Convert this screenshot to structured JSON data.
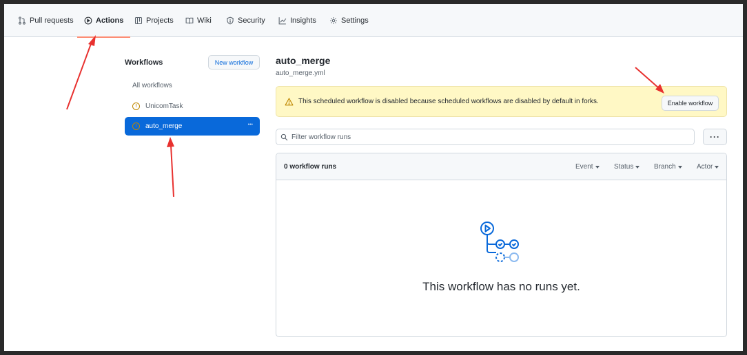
{
  "nav": {
    "tabs": [
      {
        "label": "Pull requests",
        "icon": "pull-request-icon"
      },
      {
        "label": "Actions",
        "icon": "play-icon"
      },
      {
        "label": "Projects",
        "icon": "table-icon"
      },
      {
        "label": "Wiki",
        "icon": "book-icon"
      },
      {
        "label": "Security",
        "icon": "shield-icon"
      },
      {
        "label": "Insights",
        "icon": "graph-icon"
      },
      {
        "label": "Settings",
        "icon": "gear-icon"
      }
    ],
    "active_tab": "Actions"
  },
  "sidebar": {
    "title": "Workflows",
    "new_workflow_label": "New workflow",
    "items": [
      {
        "label": "All workflows"
      },
      {
        "label": "UnicomTask",
        "icon": "warning-circle-icon"
      },
      {
        "label": "auto_merge",
        "icon": "warning-circle-icon",
        "selected": true
      }
    ]
  },
  "main": {
    "workflow_name": "auto_merge",
    "workflow_file": "auto_merge.yml",
    "banner": {
      "text": "This scheduled workflow is disabled because scheduled workflows are disabled by default in forks.",
      "button_label": "Enable workflow",
      "icon": "alert-icon"
    },
    "filter": {
      "placeholder": "Filter workflow runs",
      "icon": "search-icon"
    },
    "more_label": "···",
    "runs": {
      "count_label": "0 workflow runs",
      "filters": [
        "Event",
        "Status",
        "Branch",
        "Actor"
      ],
      "empty_message": "This workflow has no runs yet."
    }
  },
  "colors": {
    "accent": "#0969da",
    "active_underline": "#fd8c73",
    "warning": "#bf8700",
    "banner_bg": "#fff8c5",
    "annotation_arrow": "#e8312f"
  }
}
